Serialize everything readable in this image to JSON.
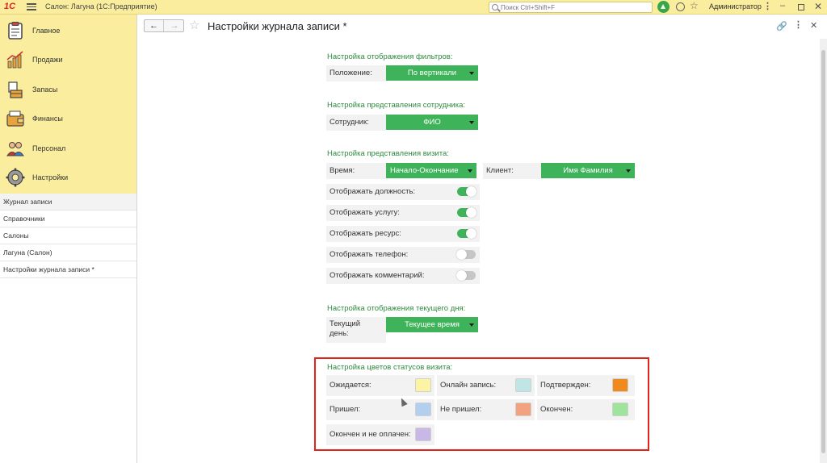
{
  "app": {
    "logo": "1С",
    "title": "Салон: Лагуна  (1С:Предприятие)",
    "search_placeholder": "Поиск Ctrl+Shift+F",
    "user": "Администратор"
  },
  "sidebar": {
    "sections": [
      {
        "label": "Главное",
        "icon": "clipboard-icon"
      },
      {
        "label": "Продажи",
        "icon": "sales-chart-icon"
      },
      {
        "label": "Запасы",
        "icon": "stock-box-icon"
      },
      {
        "label": "Финансы",
        "icon": "wallet-icon"
      },
      {
        "label": "Персонал",
        "icon": "people-icon"
      },
      {
        "label": "Настройки",
        "icon": "gear-icon"
      }
    ],
    "open_windows": [
      "Журнал записи",
      "Справочники",
      "Салоны",
      "Лагуна (Салон)",
      "Настройки журнала записи *"
    ]
  },
  "page": {
    "title": "Настройки журнала записи *"
  },
  "form": {
    "filters": {
      "title": "Настройка отображения фильтров:",
      "position_label": "Положение:",
      "position_value": "По вертикали"
    },
    "employee": {
      "title": "Настройка представления сотрудника:",
      "label": "Сотрудник:",
      "value": "ФИО"
    },
    "visit": {
      "title": "Настройка представления визита:",
      "time_label": "Время:",
      "time_value": "Начало-Окончание",
      "client_label": "Клиент:",
      "client_value": "Имя Фамилия",
      "toggles": [
        {
          "label": "Отображать должность:",
          "on": true
        },
        {
          "label": "Отображать услугу:",
          "on": true
        },
        {
          "label": "Отображать ресурс:",
          "on": true
        },
        {
          "label": "Отображать телефон:",
          "on": false
        },
        {
          "label": "Отображать комментарий:",
          "on": false
        }
      ]
    },
    "current_day": {
      "title": "Настройка отображения текущего дня:",
      "label_line1": "Текущий",
      "label_line2": "день:",
      "value": "Текущее время"
    },
    "status_colors": {
      "title": "Настройка цветов статусов визита:",
      "items": [
        {
          "label": "Ожидается:",
          "color": "#fdf3a5"
        },
        {
          "label": "Онлайн запись:",
          "color": "#bfe6e4"
        },
        {
          "label": "Подтвержден:",
          "color": "#f08a1c"
        },
        {
          "label": "Пришел:",
          "color": "#b3cff0"
        },
        {
          "label": "Не пришел:",
          "color": "#f3a27f"
        },
        {
          "label": "Окончен:",
          "color": "#9ee59b"
        },
        {
          "label": "Окончен и не оплачен:",
          "color": "#c9b8e6"
        }
      ]
    }
  },
  "colors": {
    "accent_green": "#3fb35a",
    "section_bg": "#fbed9e",
    "highlight_border": "#e2231a"
  }
}
